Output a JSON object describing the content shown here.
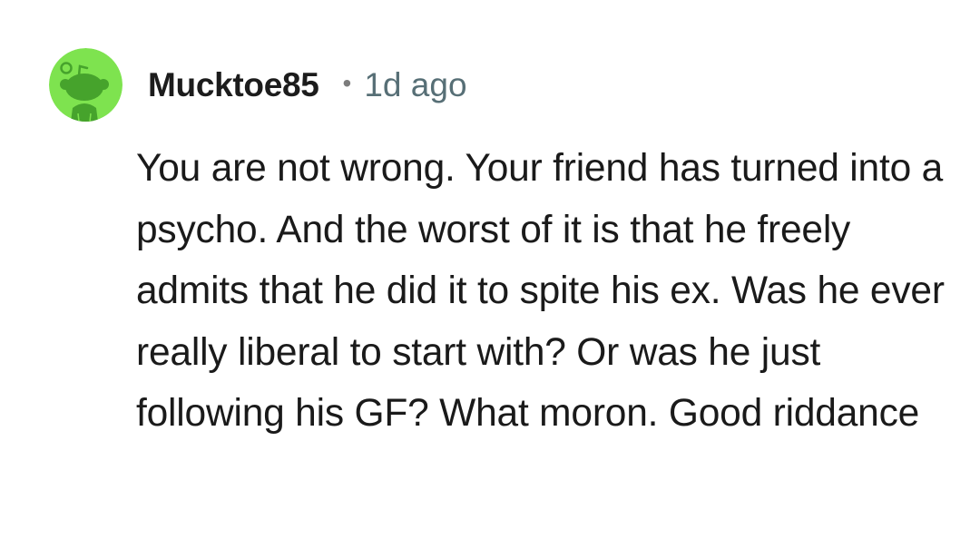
{
  "comment": {
    "username": "Mucktoe85",
    "separator": "•",
    "timestamp": "1d ago",
    "body": "You are not wrong. Your friend has turned into a psycho. And the worst of it is that he freely admits that he did it to spite his ex. Was he ever really liberal to start with? Or was he just following his GF? What moron. Good riddance"
  },
  "avatar": {
    "icon": "reddit-snoo-avatar-icon",
    "background_color": "#7ee34f",
    "figure_color": "#46a32c"
  }
}
